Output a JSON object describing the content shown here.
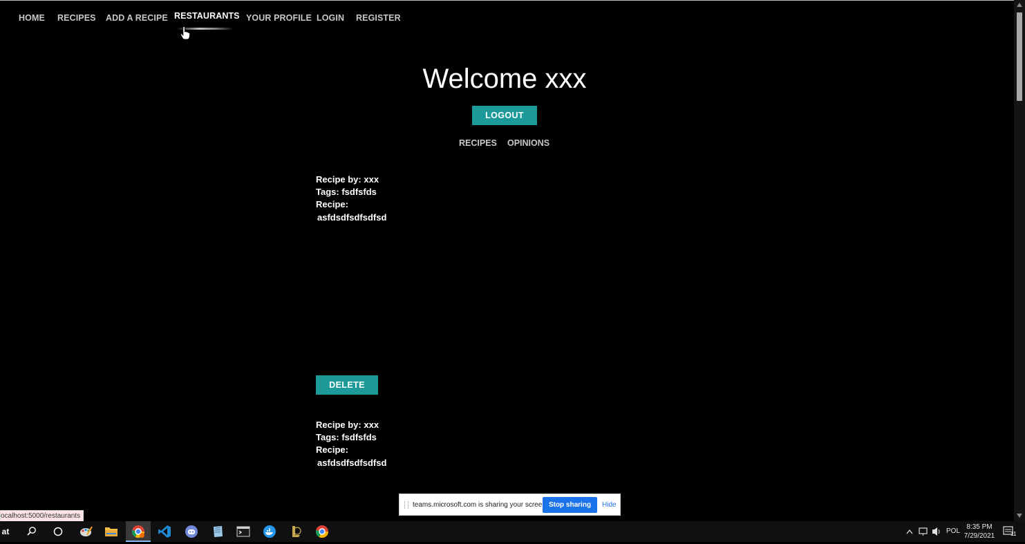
{
  "nav": {
    "items": [
      {
        "label": "HOME"
      },
      {
        "label": "RECIPES"
      },
      {
        "label": "ADD A RECIPE"
      },
      {
        "label": "RESTAURANTS"
      },
      {
        "label": "YOUR PROFILE"
      },
      {
        "label": "LOGIN"
      },
      {
        "label": "REGISTER"
      }
    ]
  },
  "profile": {
    "welcome": "Welcome xxx",
    "logout_label": "LOGOUT",
    "tabs": [
      {
        "label": "RECIPES"
      },
      {
        "label": "OPINIONS"
      }
    ]
  },
  "recipes": [
    {
      "author": "Recipe by: xxx",
      "tags": "Tags: fsdfsfds",
      "recipe_label": "Recipe:",
      "body": "asfdsdfsdfsdfsd",
      "delete_label": "DELETE"
    },
    {
      "author": "Recipe by: xxx",
      "tags": "Tags: fsdfsfds",
      "recipe_label": "Recipe:",
      "body": "asfdsdfsdfsdfsd"
    }
  ],
  "status_bar": {
    "url": "ocalhost:5000/restaurants"
  },
  "share_bar": {
    "message": "teams.microsoft.com is sharing your screen.",
    "stop_label": "Stop sharing",
    "hide_label": "Hide"
  },
  "taskbar": {
    "start_text": "at",
    "apps": [
      "paint-icon",
      "file-explorer-icon",
      "chrome-profile-icon",
      "vscode-icon",
      "discord-icon",
      "notes-icon",
      "terminal-icon",
      "docker-icon",
      "league-icon",
      "chrome-icon"
    ],
    "language": "POL",
    "time": "8:35 PM",
    "date": "7/29/2021",
    "notification_count": "11"
  },
  "colors": {
    "accent": "#1c9a9a",
    "background": "#000000",
    "share_button": "#1a73e8"
  }
}
